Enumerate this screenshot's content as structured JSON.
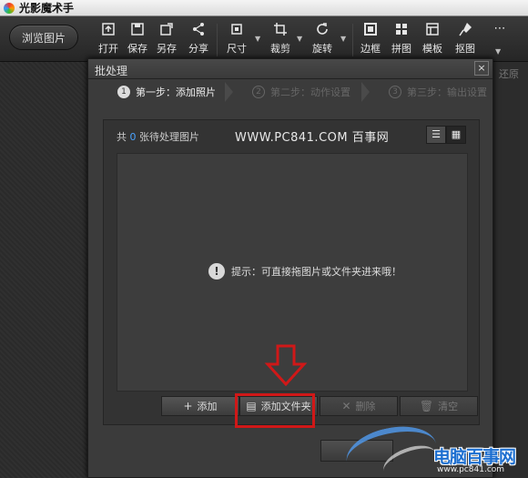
{
  "app": {
    "title": "光影魔术手"
  },
  "toolbar": {
    "browse_label": "浏览图片",
    "tools": [
      {
        "label": "打开",
        "icon": "open-icon"
      },
      {
        "label": "保存",
        "icon": "save-icon"
      },
      {
        "label": "另存",
        "icon": "save-as-icon"
      },
      {
        "label": "分享",
        "icon": "share-icon"
      },
      {
        "label": "尺寸",
        "icon": "resize-icon"
      },
      {
        "label": "裁剪",
        "icon": "crop-icon"
      },
      {
        "label": "旋转",
        "icon": "rotate-icon"
      },
      {
        "label": "边框",
        "icon": "border-icon"
      },
      {
        "label": "拼图",
        "icon": "collage-icon"
      },
      {
        "label": "模板",
        "icon": "template-icon"
      },
      {
        "label": "抠图",
        "icon": "cutout-icon"
      }
    ],
    "more_glyph": "⋯"
  },
  "background": {
    "right_label": "还原"
  },
  "dialog": {
    "title": "批处理",
    "close_glyph": "×",
    "steps": [
      {
        "num": "1",
        "label": "第一步：添加照片",
        "active": true
      },
      {
        "num": "2",
        "label": "第二步：动作设置",
        "active": false
      },
      {
        "num": "3",
        "label": "第三步：输出设置",
        "active": false
      }
    ],
    "count_prefix": "共",
    "count_value": "0",
    "count_suffix": "张待处理图片",
    "watermark_text": "WWW.PC841.COM 百事网",
    "view_list_glyph": "☰",
    "view_grid_glyph": "▦",
    "hint": {
      "icon": "!",
      "text": "提示：可直接拖图片或文件夹进来哦！"
    },
    "buttons": {
      "add": {
        "icon": "+",
        "label": "添加"
      },
      "add_folder": {
        "icon": "▤",
        "label": "添加文件夹"
      },
      "delete": {
        "icon": "✕",
        "label": "删除"
      },
      "clear": {
        "icon": "🗑",
        "label": "清空"
      }
    }
  },
  "site_watermark": {
    "name": "电脑百事网",
    "url": "www.pc841.com"
  },
  "colors": {
    "highlight": "#d01818",
    "count": "#4aa3ff",
    "site": "#1d6fd0"
  }
}
